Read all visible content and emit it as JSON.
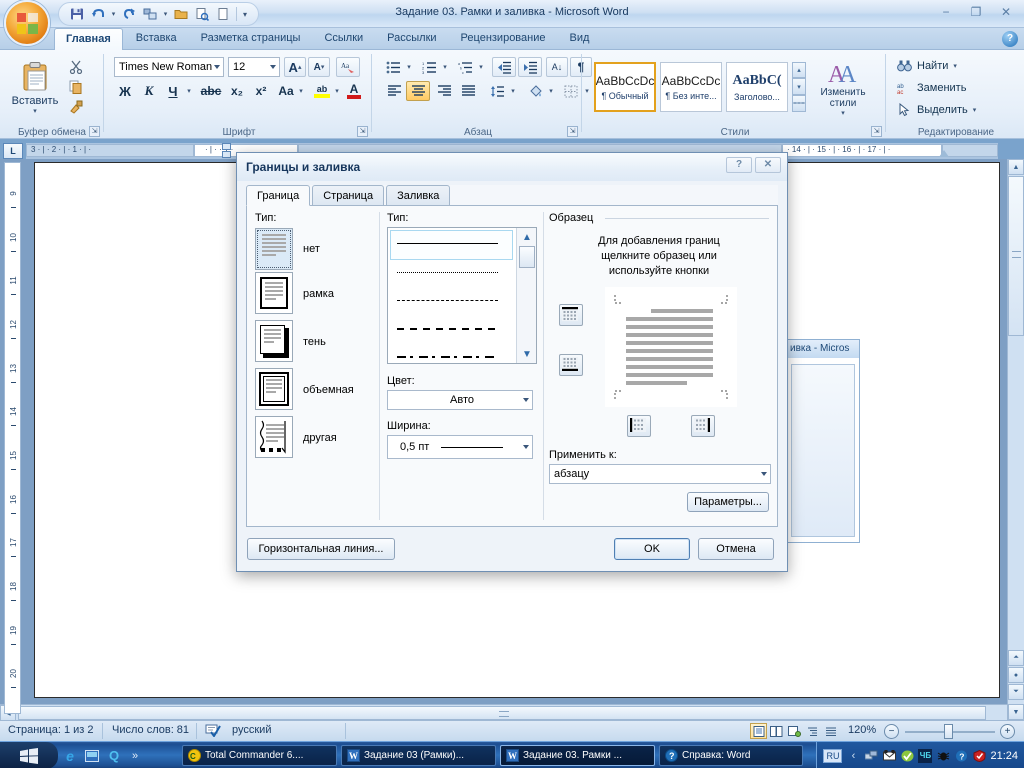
{
  "window": {
    "title": "Задание 03. Рамки и заливка - Microsoft Word",
    "office_button": "office-orb",
    "minimize": "−",
    "restore": "❐",
    "close": "✕",
    "help": "?"
  },
  "quick_access": [
    {
      "name": "save",
      "glyph": "💾"
    },
    {
      "name": "undo",
      "glyph": "↶"
    },
    {
      "name": "undo-dropdown",
      "glyph": "▾"
    },
    {
      "name": "redo",
      "glyph": "↻"
    },
    {
      "name": "tables",
      "glyph": "⛁"
    },
    {
      "name": "tables-dropdown",
      "glyph": "▾"
    },
    {
      "name": "open",
      "glyph": "📂"
    },
    {
      "name": "print-preview",
      "glyph": "🔍"
    },
    {
      "name": "new",
      "glyph": "🗋"
    },
    {
      "name": "customize-qat",
      "glyph": "▾"
    }
  ],
  "ribbon": {
    "tabs": [
      {
        "label": "Главная",
        "active": true
      },
      {
        "label": "Вставка",
        "active": false
      },
      {
        "label": "Разметка страницы",
        "active": false
      },
      {
        "label": "Ссылки",
        "active": false
      },
      {
        "label": "Рассылки",
        "active": false
      },
      {
        "label": "Рецензирование",
        "active": false
      },
      {
        "label": "Вид",
        "active": false
      }
    ],
    "groups": {
      "clipboard": {
        "label": "Буфер обмена",
        "paste_label": "Вставить",
        "cut": "✂",
        "copy": "⧉",
        "format_painter": "🖌"
      },
      "font": {
        "label": "Шрифт",
        "font_name": "Times New Roman",
        "font_size": "12",
        "grow_font": "A",
        "shrink_font": "A",
        "clear_formatting": "Aa",
        "bold": "Ж",
        "italic": "К",
        "underline": "Ч",
        "strikethrough": "abc",
        "subscript": "x₂",
        "superscript": "x²",
        "change_case": "Aa",
        "highlight": "ab",
        "font_color": "A"
      },
      "paragraph": {
        "label": "Абзац",
        "bullets": "≔",
        "numbering": "≕",
        "multilevel": "≖",
        "decrease_indent": "⇤",
        "increase_indent": "⇥",
        "sort": "A↓",
        "show_marks": "¶",
        "align_left": "≡",
        "align_center": "≡",
        "align_right": "≡",
        "justify": "≡",
        "line_spacing": "↕",
        "shading": "▧",
        "borders": "⊞"
      },
      "styles": {
        "label": "Стили",
        "items": [
          {
            "sample": "AaBbCcDc",
            "name": "¶ Обычный",
            "selected": true
          },
          {
            "sample": "AaBbCcDc",
            "name": "¶ Без инте...",
            "selected": false
          },
          {
            "sample": "AaBbC(",
            "name": "Заголово...",
            "selected": false
          }
        ],
        "change_styles": "Изменить стили"
      },
      "editing": {
        "label": "Редактирование",
        "find": "Найти",
        "replace": "Заменить",
        "select": "Выделить"
      }
    }
  },
  "rulers": {
    "corner_tab": "L",
    "horizontal_left_marks": "3  ·  |  ·  2  ·  |  ·  1  ·  |  ·",
    "horizontal_right_marks": "·  14  ·  |  ·  15  ·  |  ·  16  ·  |  ·  17  ·  |  ·",
    "horizontal_inner_marks": "·  |  ·      ·  1  ·",
    "vertical_ticks": [
      "9",
      "10",
      "11",
      "12",
      "13",
      "14",
      "15",
      "16",
      "17",
      "18",
      "19",
      "20"
    ]
  },
  "background_window": {
    "title_fragment": "ивка - Micros"
  },
  "dialog": {
    "title": "Границы и заливка",
    "help_btn": "?",
    "close_btn": "✕",
    "tabs": [
      {
        "label": "Граница",
        "active": true
      },
      {
        "label": "Страница",
        "active": false
      },
      {
        "label": "Заливка",
        "active": false
      }
    ],
    "type_label": "Тип:",
    "border_types": [
      {
        "label": "нет",
        "selected": true
      },
      {
        "label": "рамка",
        "selected": false
      },
      {
        "label": "тень",
        "selected": false
      },
      {
        "label": "объемная",
        "selected": false
      },
      {
        "label": "другая",
        "selected": false
      }
    ],
    "style_label": "Тип:",
    "line_styles": [
      {
        "name": "solid",
        "selected": true
      },
      {
        "name": "dotted",
        "selected": false
      },
      {
        "name": "dashed-small",
        "selected": false
      },
      {
        "name": "dashed-medium",
        "selected": false
      },
      {
        "name": "dash-dot",
        "selected": false
      }
    ],
    "color_label": "Цвет:",
    "color_value": "Авто",
    "width_label": "Ширина:",
    "width_value": "0,5 пт",
    "preview_label": "Образец",
    "preview_hint_line1": "Для добавления границ",
    "preview_hint_line2": "щелкните образец или",
    "preview_hint_line3": "используйте кнопки",
    "preview_buttons": [
      {
        "name": "top-border-button"
      },
      {
        "name": "bottom-border-button"
      },
      {
        "name": "left-border-button"
      },
      {
        "name": "right-border-button"
      }
    ],
    "apply_to_label": "Применить к:",
    "apply_to_value": "абзацу",
    "options_button": "Параметры...",
    "horizontal_line_button": "Горизонтальная линия...",
    "ok_button": "OK",
    "cancel_button": "Отмена"
  },
  "status_bar": {
    "page": "Страница: 1 из 2",
    "words": "Число слов: 81",
    "proofing_icon": "spellcheck-icon",
    "language": "русский",
    "view_buttons": [
      {
        "name": "print-layout-view",
        "selected": true
      },
      {
        "name": "full-screen-reading-view",
        "selected": false
      },
      {
        "name": "web-layout-view",
        "selected": false
      },
      {
        "name": "outline-view",
        "selected": false
      },
      {
        "name": "draft-view",
        "selected": false
      }
    ],
    "zoom": "120%",
    "zoom_out": "−",
    "zoom_in": "+"
  },
  "taskbar": {
    "start_label": "start",
    "quick_launch": [
      {
        "name": "internet-explorer-icon",
        "glyph": "e"
      },
      {
        "name": "show-desktop-icon",
        "glyph": "▤"
      },
      {
        "name": "search-icon",
        "glyph": "Q"
      },
      {
        "name": "more-icon",
        "glyph": "»"
      }
    ],
    "tasks": [
      {
        "label": "Total Commander 6....",
        "icon": "total-commander-icon",
        "active": false
      },
      {
        "label": "Задание 03 (Рамки)...",
        "icon": "word-icon",
        "active": false
      },
      {
        "label": "Задание 03. Рамки ...",
        "icon": "word-icon",
        "active": true
      },
      {
        "label": "Справка: Word",
        "icon": "help-icon",
        "active": false
      }
    ],
    "tray": [
      {
        "name": "language-indicator",
        "glyph": "RU"
      },
      {
        "name": "show-hidden-icons",
        "glyph": "‹"
      },
      {
        "name": "network-icon",
        "glyph": "🖧"
      },
      {
        "name": "mail-icon",
        "glyph": "✉"
      },
      {
        "name": "antivirus-icon",
        "glyph": "✔"
      },
      {
        "name": "punto-switcher-icon",
        "glyph": "ЧБ"
      },
      {
        "name": "bug-icon",
        "glyph": "🐞"
      },
      {
        "name": "help-tray-icon",
        "glyph": "?"
      },
      {
        "name": "security-center-icon",
        "glyph": "🛡"
      }
    ],
    "clock": "21:24"
  },
  "colors": {
    "accent": "#1d4876",
    "ribbon_bg": "#e6eff9",
    "taskbar": "#2f71bb",
    "selection_gold": "#e3a11d",
    "doc_bg": "#7e9fc4"
  }
}
